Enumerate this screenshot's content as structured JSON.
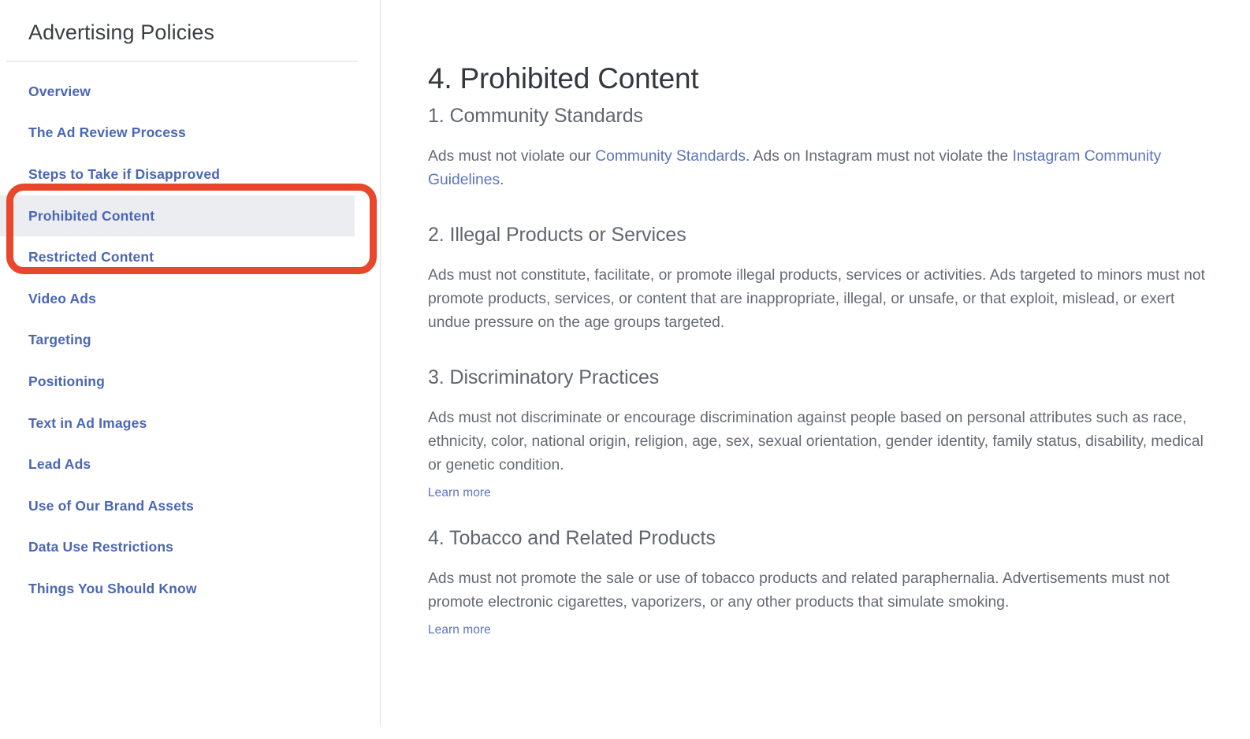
{
  "sidebar": {
    "title": "Advertising Policies",
    "items": [
      {
        "label": "Overview",
        "active": false
      },
      {
        "label": "The Ad Review Process",
        "active": false
      },
      {
        "label": "Steps to Take if Disapproved",
        "active": false
      },
      {
        "label": "Prohibited Content",
        "active": true
      },
      {
        "label": "Restricted Content",
        "active": false
      },
      {
        "label": "Video Ads",
        "active": false
      },
      {
        "label": "Targeting",
        "active": false
      },
      {
        "label": "Positioning",
        "active": false
      },
      {
        "label": "Text in Ad Images",
        "active": false
      },
      {
        "label": "Lead Ads",
        "active": false
      },
      {
        "label": "Use of Our Brand Assets",
        "active": false
      },
      {
        "label": "Data Use Restrictions",
        "active": false
      },
      {
        "label": "Things You Should Know",
        "active": false
      }
    ]
  },
  "annotation": {
    "color": "#e8472c",
    "highlights": [
      "Prohibited Content",
      "Restricted Content"
    ]
  },
  "main": {
    "title": "4. Prohibited Content",
    "sections": [
      {
        "heading": "1. Community Standards",
        "body_parts": [
          {
            "type": "text",
            "text": "Ads must not violate our "
          },
          {
            "type": "link",
            "text": "Community Standards"
          },
          {
            "type": "text",
            "text": ". Ads on Instagram must not violate the "
          },
          {
            "type": "link",
            "text": "Instagram Community Guidelines"
          },
          {
            "type": "text",
            "text": "."
          }
        ],
        "learn_more": null
      },
      {
        "heading": "2. Illegal Products or Services",
        "body_parts": [
          {
            "type": "text",
            "text": "Ads must not constitute, facilitate, or promote illegal products, services or activities. Ads targeted to minors must not promote products, services, or content that are inappropriate, illegal, or unsafe, or that exploit, mislead, or exert undue pressure on the age groups targeted."
          }
        ],
        "learn_more": null
      },
      {
        "heading": "3. Discriminatory Practices",
        "body_parts": [
          {
            "type": "text",
            "text": "Ads must not discriminate or encourage discrimination against people based on personal attributes such as race, ethnicity, color, national origin, religion, age, sex, sexual orientation, gender identity, family status, disability, medical or genetic condition."
          }
        ],
        "learn_more": "Learn more"
      },
      {
        "heading": "4. Tobacco and Related Products",
        "body_parts": [
          {
            "type": "text",
            "text": "Ads must not promote the sale or use of tobacco products and related paraphernalia. Advertisements must not promote electronic cigarettes, vaporizers, or any other products that simulate smoking."
          }
        ],
        "learn_more": "Learn more"
      }
    ]
  },
  "colors": {
    "sidebar_link": "#4a66b5",
    "content_link": "#5c74bf",
    "body_text": "#656a72",
    "heading_text": "#62666d",
    "title_text": "#34383d",
    "active_row_bg": "#ebedf0",
    "annotation_red": "#e8472c",
    "divider": "#dddfe2"
  }
}
